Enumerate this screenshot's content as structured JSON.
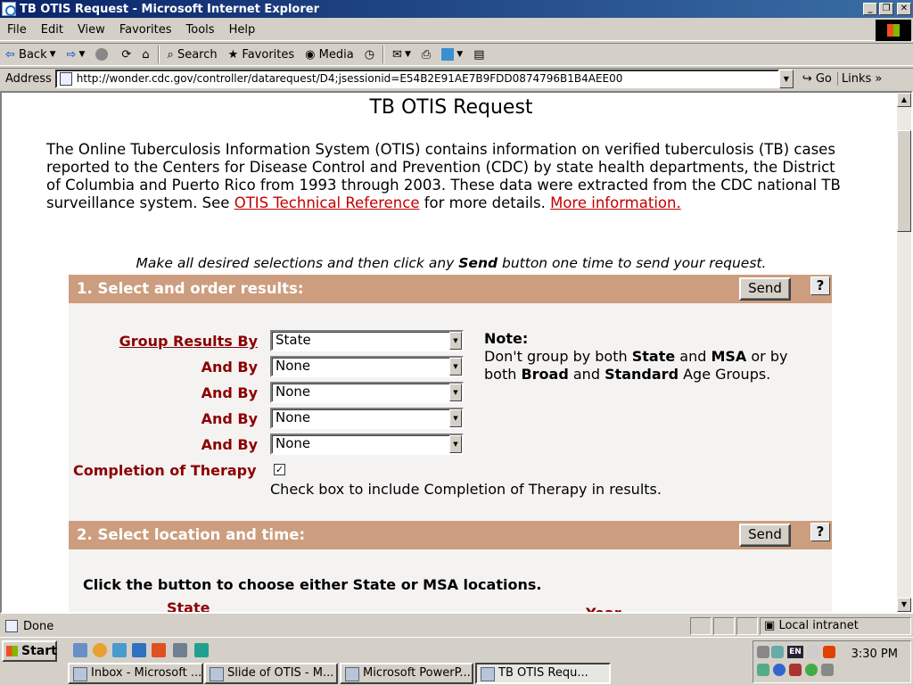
{
  "window": {
    "title": "TB OTIS Request - Microsoft Internet Explorer"
  },
  "menu": {
    "items": [
      "File",
      "Edit",
      "View",
      "Favorites",
      "Tools",
      "Help"
    ]
  },
  "toolbar": {
    "back": "Back",
    "search": "Search",
    "favorites": "Favorites",
    "media": "Media"
  },
  "address": {
    "label": "Address",
    "url": "http://wonder.cdc.gov/controller/datarequest/D4;jsessionid=E54B2E91AE7B9FDD0874796B1B4AEE00",
    "go": "Go",
    "links": "Links"
  },
  "page": {
    "title": "TB OTIS Request",
    "intro_text": "The Online Tuberculosis Information System (OTIS) contains information on verified tuberculosis (TB) cases reported to the Centers for Disease Control and Prevention (CDC) by state health departments, the District of Columbia and Puerto Rico from 1993 through 2003. These data were extracted from the CDC national TB surveillance system. See ",
    "tech_ref_link": "OTIS Technical Reference",
    "intro_mid": " for more details. ",
    "more_info_link": "More information.",
    "instr_pre": "Make all desired selections and then click any ",
    "instr_bold": "Send",
    "instr_post": " button one time to send your request."
  },
  "section1": {
    "title": "1. Select and order results:",
    "send": "Send",
    "help": "?",
    "group_by_label": "Group Results By",
    "and_by_label": "And By",
    "group_by_value": "State",
    "and_by_values": [
      "None",
      "None",
      "None",
      "None"
    ],
    "note_title": "Note:",
    "note_1": "Don't group by both ",
    "note_b1": "State",
    "note_2": " and ",
    "note_b2": "MSA",
    "note_3": " or by both ",
    "note_b3": "Broad",
    "note_4": " and ",
    "note_b4": "Standard",
    "note_5": " Age Groups.",
    "completion_label": "Completion of Therapy",
    "completion_checked": true,
    "completion_check_glyph": "✓",
    "completion_help": "Check box to include Completion of Therapy in results."
  },
  "section2": {
    "title": "2. Select location and time:",
    "send": "Send",
    "help": "?",
    "instruction": "Click the button to choose either State or MSA locations.",
    "state_label": "State",
    "year_label": "Year"
  },
  "status": {
    "text": "Done",
    "zone": "Local intranet"
  },
  "taskbar": {
    "start": "Start",
    "tasks": [
      "Inbox - Microsoft ...",
      "Slide of OTIS - M...",
      "Microsoft PowerP...",
      "TB OTIS Requ..."
    ],
    "active_task": 3,
    "clock": "3:30 PM",
    "lang": "EN"
  }
}
